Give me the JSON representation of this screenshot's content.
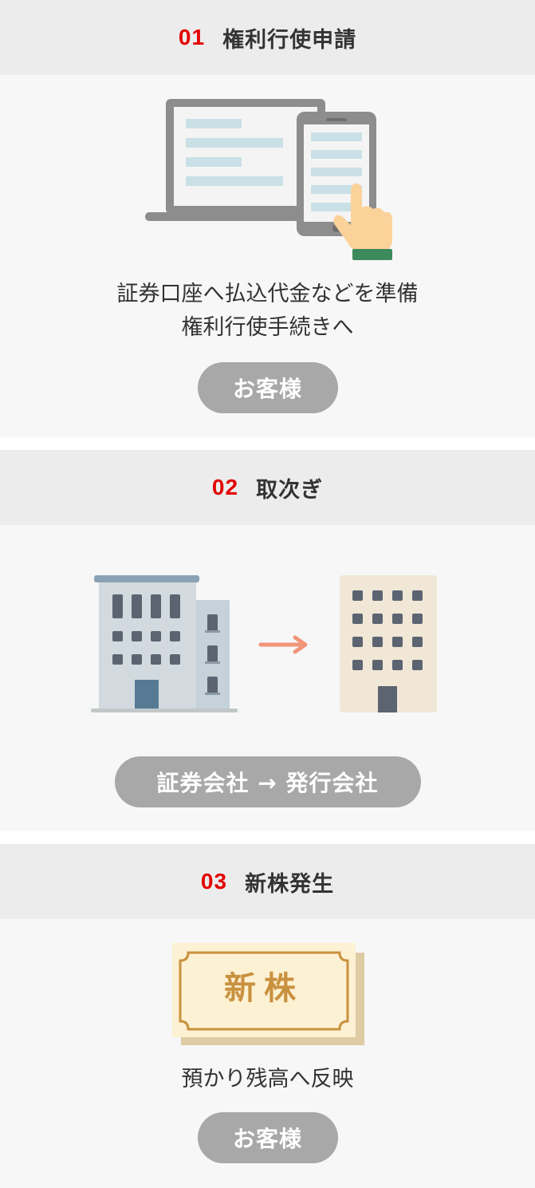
{
  "steps": [
    {
      "number": "01",
      "title": "権利行使申請",
      "description": [
        "証券口座へ払込代金などを準備",
        "権利行使手続きへ"
      ],
      "actor": "お客様"
    },
    {
      "number": "02",
      "title": "取次ぎ",
      "flow": "証券会社 → 発行会社"
    },
    {
      "number": "03",
      "title": "新株発生",
      "certificate_label": "新株",
      "description": [
        "預かり残高へ反映"
      ],
      "actor": "お客様"
    }
  ],
  "colors": {
    "step_number": "#e30000",
    "header_bg": "#ececec",
    "panel_bg": "#f7f7f7",
    "pill_bg": "#a8a8a8",
    "arrow": "#f0957a",
    "certificate_border": "#c9913f",
    "certificate_fill": "#fdf1d3"
  }
}
